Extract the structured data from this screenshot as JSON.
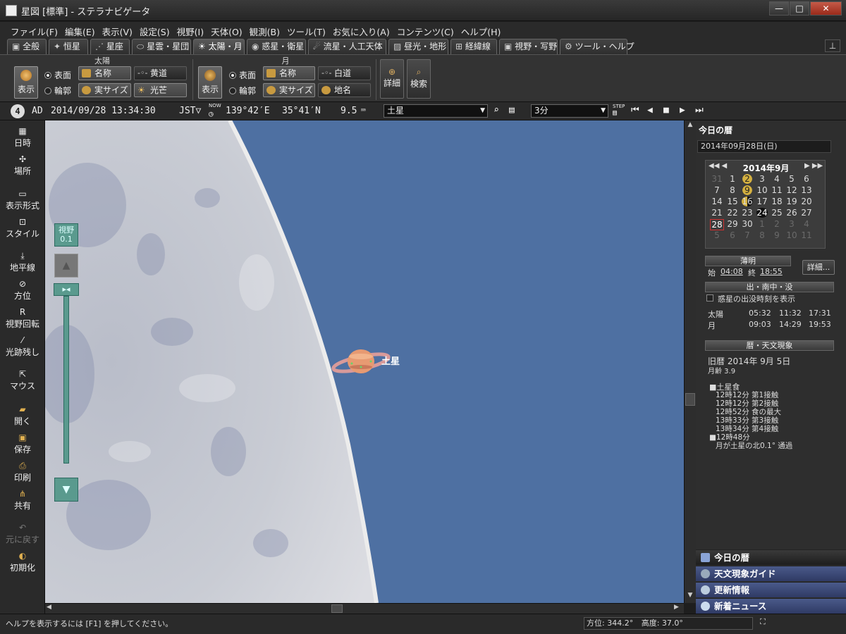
{
  "window": {
    "title": "星図 [標準] - ステラナビゲータ",
    "btn_min": "—",
    "btn_max": "□",
    "btn_close": "✕"
  },
  "menu": [
    "ファイル(F)",
    "編集(E)",
    "表示(V)",
    "設定(S)",
    "視野(I)",
    "天体(O)",
    "観測(B)",
    "ツール(T)",
    "お気に入り(A)",
    "コンテンツ(C)",
    "ヘルプ(H)"
  ],
  "tabs": [
    "全般",
    "恒星",
    "星座",
    "星雲・星団",
    "太陽・月",
    "惑星・衛星",
    "流星・人工天体",
    "昼光・地形",
    "経緯線",
    "視野・写野",
    "ツール・ヘルプ"
  ],
  "ribbon": {
    "sun_group": "太陽",
    "moon_group": "月",
    "show": "表示",
    "surface": "表面",
    "outline": "輪郭",
    "name": "名称",
    "real_size": "実サイズ",
    "ecliptic": "黄道",
    "corona": "光芒",
    "white_path": "白道",
    "place_name": "地名",
    "detail": "詳細",
    "search": "検索"
  },
  "statusline": {
    "badge": "4",
    "era": "AD",
    "datetime": "2014/09/28 13:34:30",
    "tz": "JST▽",
    "now_label": "NOW",
    "lon": "139°42′E",
    "lat": "35°41′N",
    "mag": "9.5",
    "target": "土星",
    "step": "3分",
    "step_label": "STEP"
  },
  "lefttools": [
    "日時",
    "場所",
    "表示形式",
    "スタイル",
    "地平線",
    "方位",
    "視野回転",
    "光跡残し",
    "マウス",
    "開く",
    "保存",
    "印刷",
    "共有",
    "元に戻す",
    "初期化"
  ],
  "fov": {
    "label": "視野",
    "value": "0.1"
  },
  "sky": {
    "saturn_label": "土星"
  },
  "panel": {
    "title": "今日の暦",
    "date": "2014年09月28日(日)",
    "calendar": {
      "month": "2014年9月",
      "prev": "◀◀ ◀",
      "next": "▶ ▶▶",
      "weeks": [
        [
          "31",
          "1",
          "2",
          "3",
          "4",
          "5",
          "6"
        ],
        [
          "7",
          "8",
          "9",
          "10",
          "11",
          "12",
          "13"
        ],
        [
          "14",
          "15",
          "16",
          "17",
          "18",
          "19",
          "20"
        ],
        [
          "21",
          "22",
          "23",
          "24",
          "25",
          "26",
          "27"
        ],
        [
          "28",
          "29",
          "30",
          "1",
          "2",
          "3",
          "4"
        ],
        [
          "5",
          "6",
          "7",
          "8",
          "9",
          "10",
          "11"
        ]
      ]
    },
    "twilight": {
      "title": "薄明",
      "start_label": "始",
      "start": "04:08",
      "end_label": "終",
      "end": "18:55",
      "detail_btn": "詳細..."
    },
    "rise": {
      "title": "出・南中・没",
      "checkbox": "惑星の出没時刻を表示",
      "rows": [
        {
          "name": "太陽",
          "rise": "05:32",
          "transit": "11:32",
          "set": "17:31"
        },
        {
          "name": "月",
          "rise": "09:03",
          "transit": "14:29",
          "set": "19:53"
        }
      ]
    },
    "events": {
      "title": "暦・天文現象",
      "lunar_date": "旧暦 2014年 9月 5日",
      "moon_age": "月齢 3.9",
      "lines": [
        "■土星食",
        "12時12分 第1接触",
        "12時12分 第2接触",
        "12時52分 食の最大",
        "13時33分 第3接触",
        "13時34分 第4接触",
        "■12時48分",
        "月が土星の北0.1° 通過"
      ]
    },
    "buttons": [
      "今日の暦",
      "天文現象ガイド",
      "更新情報",
      "新着ニュース"
    ]
  },
  "statusbar": {
    "help": "ヘルプを表示するには [F1] を押してください。",
    "azimuth": "方位: 344.2°",
    "altitude": "高度:  37.0°"
  }
}
